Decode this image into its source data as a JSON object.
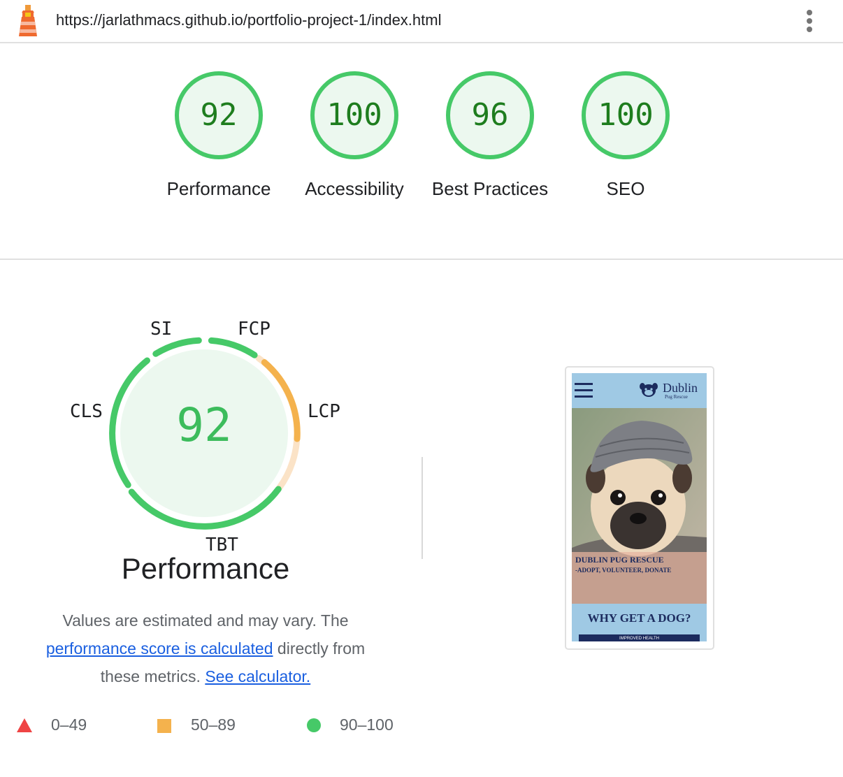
{
  "url": "https://jarlathmacs.github.io/portfolio-project-1/index.html",
  "categories": [
    {
      "name": "Performance",
      "score": 92
    },
    {
      "name": "Accessibility",
      "score": 100
    },
    {
      "name": "Best Practices",
      "score": 96
    },
    {
      "name": "SEO",
      "score": 100
    }
  ],
  "performance": {
    "score": 92,
    "title": "Performance",
    "metrics": {
      "si": "SI",
      "fcp": "FCP",
      "lcp": "LCP",
      "tbt": "TBT",
      "cls": "CLS"
    },
    "description": {
      "part1": "Values are estimated and may vary. The ",
      "link1": "performance score is calculated",
      "part2": " directly from these metrics. ",
      "link2": "See calculator."
    }
  },
  "legend": [
    {
      "label": "0–49",
      "shape": "triangle",
      "color": "#ef4444"
    },
    {
      "label": "50–89",
      "shape": "square",
      "color": "#f4b24d"
    },
    {
      "label": "90–100",
      "shape": "circle",
      "color": "#46c968"
    }
  ],
  "screenshot": {
    "brand": "Dublin",
    "brand_sub": "Pug Rescue",
    "hero_title": "DUBLIN PUG RESCUE",
    "hero_subtitle": "-ADOPT, VOLUNTEER, DONATE",
    "section_title": "WHY GET A DOG?",
    "card_label": "IMPROVED HEALTH"
  },
  "colors": {
    "pass": "#0cce6b",
    "pass_text": "#1e7d1e",
    "average": "#f4b24d",
    "fail": "#ef4444",
    "link": "#1a5fe0"
  }
}
